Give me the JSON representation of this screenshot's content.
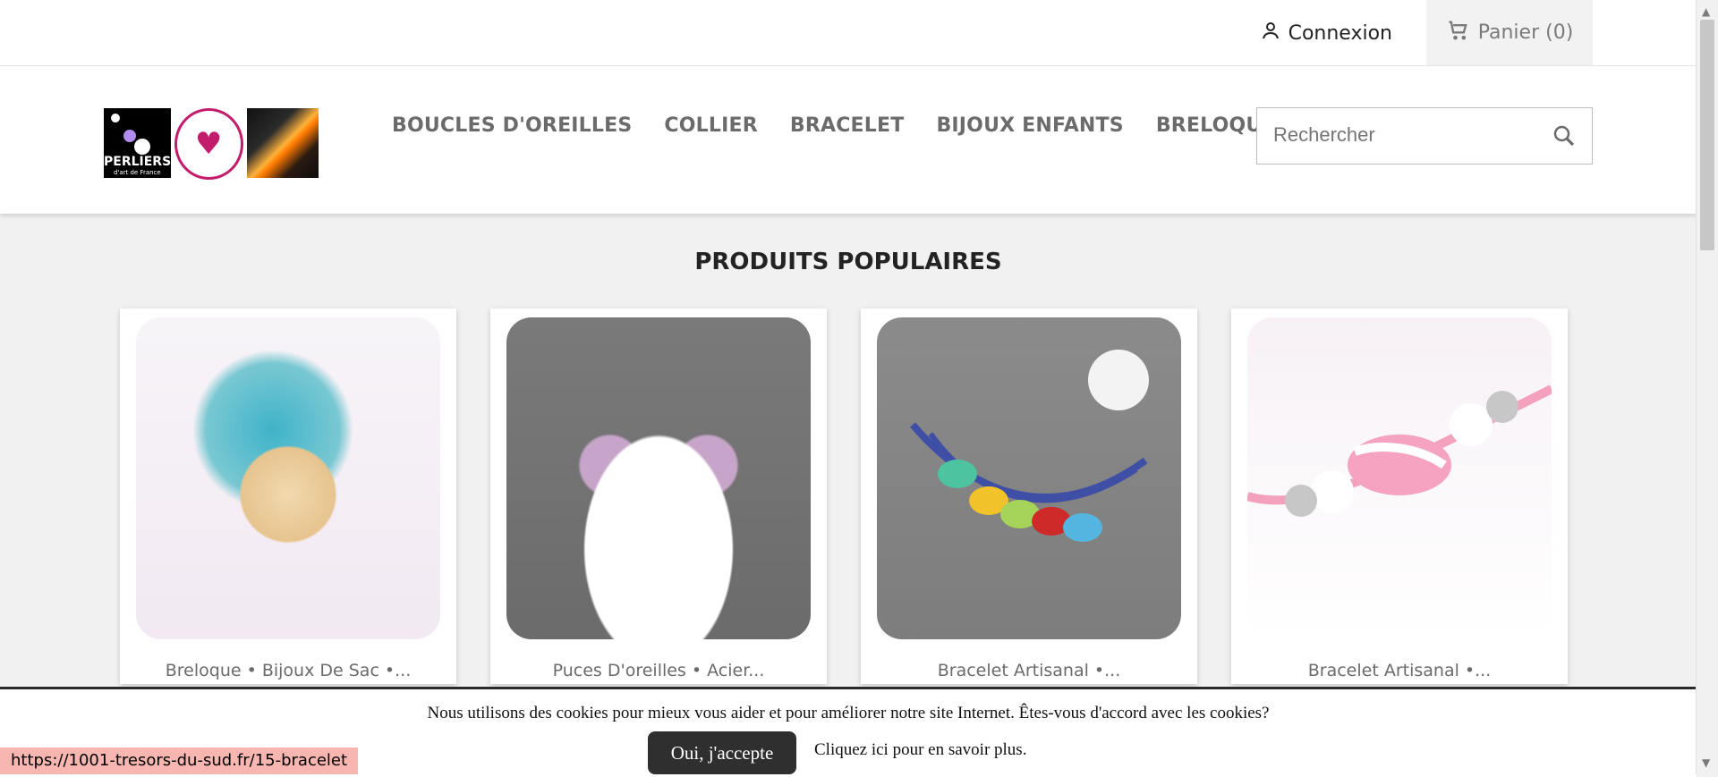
{
  "topbar": {
    "login_label": "Connexion",
    "cart_label": "Panier (0)",
    "login_icon": "user-icon",
    "cart_icon": "cart-icon"
  },
  "header": {
    "logo": {
      "line1": "PERLIERS",
      "line2": "d'art de France"
    },
    "nav": [
      "BOUCLES D'OREILLES",
      "COLLIER",
      "BRACELET",
      "BIJOUX ENFANTS",
      "BRELOQUE"
    ],
    "search": {
      "placeholder": "Rechercher",
      "icon": "search-icon"
    }
  },
  "main": {
    "section_title": "PRODUITS POPULAIRES",
    "products": [
      {
        "name": "Breloque • Bijoux De Sac •..."
      },
      {
        "name": "Puces D'oreilles • Acier..."
      },
      {
        "name": "Bracelet Artisanal •..."
      },
      {
        "name": "Bracelet Artisanal •..."
      }
    ]
  },
  "cookie_banner": {
    "message": "Nous utilisons des cookies pour mieux vous aider et pour améliorer notre site Internet. Êtes-vous d'accord avec les cookies?",
    "accept_label": "Oui, j'accepte",
    "more_label": "Cliquez ici pour en savoir plus."
  },
  "status_bar": {
    "url": "https://1001-tresors-du-sud.fr/15-bracelet"
  },
  "colors": {
    "accent": "#2f2f2f",
    "status_bar_bg": "#f7b6b0"
  }
}
